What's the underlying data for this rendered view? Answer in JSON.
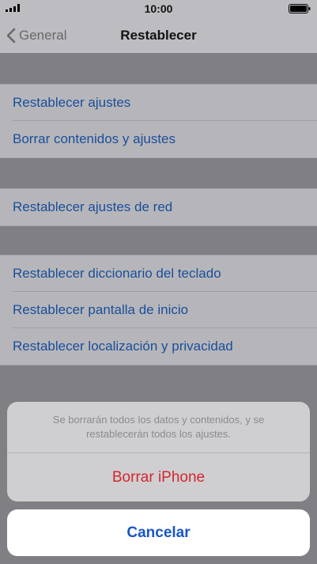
{
  "status_bar": {
    "time": "10:00"
  },
  "nav": {
    "back_label": "General",
    "title": "Restablecer"
  },
  "groups": [
    {
      "items": [
        {
          "label": "Restablecer ajustes"
        },
        {
          "label": "Borrar contenidos y ajustes"
        }
      ]
    },
    {
      "items": [
        {
          "label": "Restablecer ajustes de red"
        }
      ]
    },
    {
      "items": [
        {
          "label": "Restablecer diccionario del teclado"
        },
        {
          "label": "Restablecer pantalla de inicio"
        },
        {
          "label": "Restablecer localización y privacidad"
        }
      ]
    }
  ],
  "action_sheet": {
    "message": "Se borrarán todos los datos y contenidos, y se restablecerán todos los ajustes.",
    "destructive_label": "Borrar iPhone",
    "cancel_label": "Cancelar"
  },
  "colors": {
    "link_blue": "#1a4e9b",
    "destructive_red": "#d5262e",
    "cancel_blue": "#1a56c2"
  }
}
